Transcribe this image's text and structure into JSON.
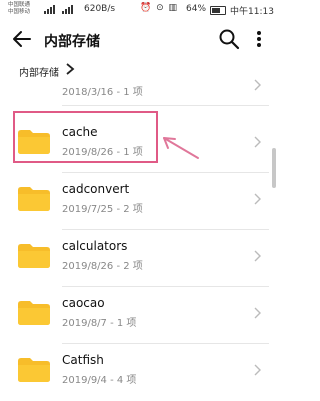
{
  "status": {
    "carrier1": "中国联通",
    "carrier2": "中国移动",
    "network_speed": "620B/s",
    "battery": "64%",
    "time": "中午11:13"
  },
  "header": {
    "title": "内部存储"
  },
  "breadcrumb": {
    "label": "内部存储"
  },
  "folders": [
    {
      "name": "",
      "meta": "2018/3/16 - 1 项"
    },
    {
      "name": "cache",
      "meta": "2019/8/26 - 1 项"
    },
    {
      "name": "cadconvert",
      "meta": "2019/7/25 - 2 项"
    },
    {
      "name": "calculators",
      "meta": "2019/8/26 - 2 项"
    },
    {
      "name": "caocao",
      "meta": "2019/8/7 - 1 项"
    },
    {
      "name": "Catfish",
      "meta": "2019/9/4 - 4 项"
    }
  ],
  "colors": {
    "folder": "#f7bd2a",
    "highlight": "#e05a86",
    "arrow": "#e0779a"
  },
  "icons": [
    "back-arrow-icon",
    "search-icon",
    "more-vert-icon",
    "chevron-right-icon",
    "folder-icon"
  ]
}
